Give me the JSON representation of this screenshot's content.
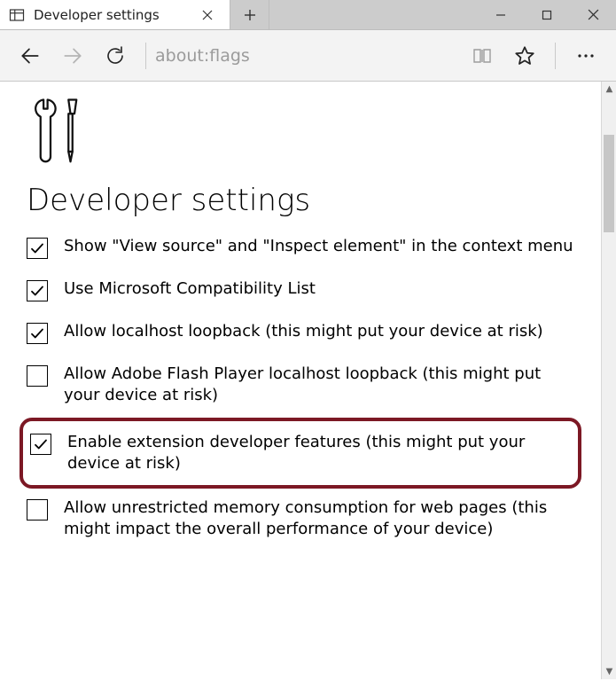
{
  "tab": {
    "title": "Developer settings"
  },
  "address": "about:flags",
  "page": {
    "heading": "Developer settings",
    "settings": [
      {
        "label": "Show \"View source\" and \"Inspect element\" in the context menu",
        "checked": true,
        "highlight": false
      },
      {
        "label": "Use Microsoft Compatibility List",
        "checked": true,
        "highlight": false
      },
      {
        "label": "Allow localhost loopback (this might put your device at risk)",
        "checked": true,
        "highlight": false
      },
      {
        "label": "Allow Adobe Flash Player localhost loopback (this might put your device at risk)",
        "checked": false,
        "highlight": false
      },
      {
        "label": "Enable extension developer features (this might put your device at risk)",
        "checked": true,
        "highlight": true
      },
      {
        "label": "Allow unrestricted memory consumption for web pages (this might impact the overall performance of your device)",
        "checked": false,
        "highlight": false
      }
    ]
  }
}
